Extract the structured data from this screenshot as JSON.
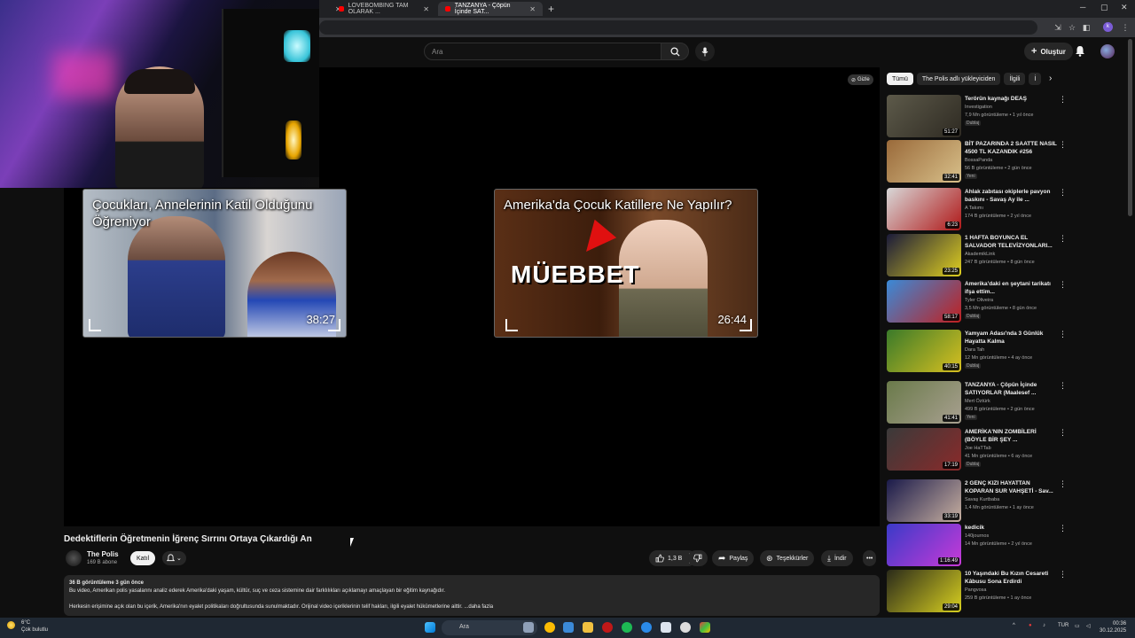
{
  "browser": {
    "tabs": [
      {
        "title": "LOVEBOMBING TAM OLARAK ..."
      },
      {
        "title": "TANZANYA - Çöpün İçinde SAT..."
      }
    ]
  },
  "header": {
    "search_placeholder": "Ara",
    "create_label": "Oluştur"
  },
  "player": {
    "hide_label": "Gizle",
    "endcards": [
      {
        "title": "Çocukları, Annelerinin Katil Olduğunu Öğreniyor",
        "duration": "38:27"
      },
      {
        "title": "Amerika'da Çocuk Katillere Ne Yapılır?",
        "duration": "26:44",
        "overlay": "MÜEBBET"
      }
    ]
  },
  "video": {
    "title": "Dedektiflerin Öğretmenin İğrenç Sırrını Ortaya Çıkardığı An",
    "channel": "The Polis",
    "subscribers": "169 B abone",
    "join_label": "Katıl",
    "likes": "1,3 B",
    "share_label": "Paylaş",
    "thanks_label": "Teşekkürler",
    "download_label": "İndir",
    "description": {
      "meta": "36 B görüntüleme  3 gün önce",
      "line1": "Bu video, Amerikan polis yasalarını analiz ederek Amerika'daki yaşam, kültür, suç ve ceza sistemine dair farklılıkları açıklamayı amaçlayan bir eğitim kaynağıdır.",
      "line2": "Herkesin erişimine açık olan bu içerik, Amerika'nın eyalet politikaları doğrultusunda sunulmaktadır. Orijinal video içeriklerinin telif hakları, ilgili eyalet hükümetlerine aittir. ...daha fazla"
    }
  },
  "sidebar": {
    "chips": [
      "Tümü",
      "The Polis adlı yükleyiciden",
      "İlgili",
      "İ"
    ],
    "recommendations": [
      {
        "title": "Terörün kaynağı DEAŞ",
        "channel": "Investigation",
        "views": "7,9 Mn görüntüleme • 1 yıl önce",
        "badge": "Dublaj",
        "duration": "51:27",
        "colors": [
          "#5d5a4a",
          "#2e2a22"
        ]
      },
      {
        "title": "BİT PAZARINDA 2 SAATTE NASIL 4500 TL KAZANDIK #256",
        "channel": "BossaPanda",
        "views": "56 B görüntüleme • 2 gün önce",
        "badge": "Yeni",
        "duration": "32:41",
        "colors": [
          "#9a6a3a",
          "#d8c08a"
        ]
      },
      {
        "title": "Ahlak zabıtası okiplerle pavyon baskını - Savaş Ay ile ...",
        "channel": "A Takımı",
        "views": "174 B görüntüleme • 2 yıl önce",
        "badge": "",
        "duration": "6:23",
        "colors": [
          "#d8d8d8",
          "#b01818"
        ]
      },
      {
        "title": "1 HAFTA BOYUNCA EL SALVADOR TELEVİZYONLARI...",
        "channel": "AkademikLink",
        "views": "247 B görüntüleme • 8 gün önce",
        "badge": "",
        "duration": "23:25",
        "colors": [
          "#1a1a3a",
          "#e0d020"
        ]
      },
      {
        "title": "Amerika'daki en şeytani tarikatı ifşa ettim...",
        "channel": "Tyler Oliveira",
        "views": "3,5 Mn görüntüleme • 8 gün önce",
        "badge": "Dublaj",
        "duration": "58:17",
        "colors": [
          "#3a8ad8",
          "#c02020"
        ]
      },
      {
        "title": "Yamyam Adası'nda 3 Günlük Hayatta Kalma",
        "channel": "Dara Tah",
        "views": "12 Mn görüntüleme • 4 ay önce",
        "badge": "Dublaj",
        "duration": "40:15",
        "colors": [
          "#3a7a2a",
          "#d8c020"
        ]
      },
      {
        "title": "TANZANYA - Çöpün İçinde SATIYORLAR (Maalesef ...",
        "channel": "Mert Öztürk",
        "views": "499 B görüntüleme • 2 gün önce",
        "badge": "Yeni",
        "duration": "41:41",
        "colors": [
          "#6a7a4a",
          "#a8a090"
        ]
      },
      {
        "title": "AMERİKA'NIN ZOMBİLERİ (BÖYLE BİR ŞEY ...",
        "channel": "Joe HaTTab",
        "views": "41 Mn görüntüleme • 6 ay önce",
        "badge": "Dublaj",
        "duration": "17:19",
        "colors": [
          "#3a3a3a",
          "#8a2a2a"
        ]
      },
      {
        "title": "2 GENÇ KIZI HAYATTAN KOPARAN SUR VAHŞETİ - Sav...",
        "channel": "Savaş Kurtbaba",
        "views": "1,4 Mn görüntüleme • 1 ay önce",
        "badge": "",
        "duration": "33:19",
        "colors": [
          "#1a1a4a",
          "#c8b0a0"
        ]
      },
      {
        "title": "kedicik",
        "channel": "140journos",
        "views": "14 Mn görüntüleme • 2 yıl önce",
        "badge": "",
        "duration": "1:16:49",
        "colors": [
          "#3a3ac8",
          "#c83ad8"
        ]
      },
      {
        "title": "10 Yaşındaki Bu Kızın Cesareti Kâbusu Sona Erdirdi",
        "channel": "Pangvosa",
        "views": "259 B görüntüleme • 1 ay önce",
        "badge": "",
        "duration": "29:04",
        "colors": [
          "#2a2a1a",
          "#d8d020"
        ]
      }
    ]
  },
  "taskbar": {
    "weather_temp": "6°C",
    "weather_desc": "Çok bulutlu",
    "search_placeholder": "Ara",
    "language": "TUR",
    "time": "00:36",
    "date": "30.12.2025"
  }
}
